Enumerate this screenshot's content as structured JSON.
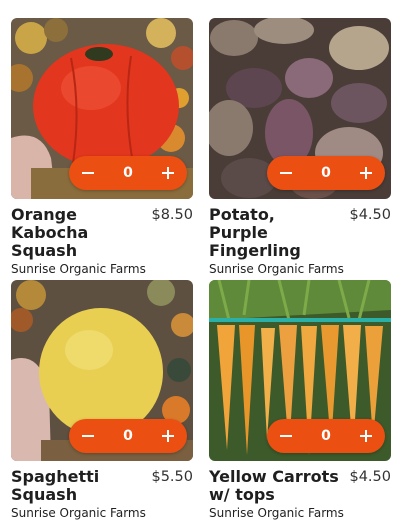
{
  "accent": "#ec4f12",
  "products": [
    {
      "name": "Orange Kabocha Squash",
      "price": "$8.50",
      "farm": "Sunrise Organic Farms",
      "quantity": "0",
      "image": "orange-kabocha-squash-photo"
    },
    {
      "name": "Potato, Purple Fingerling",
      "price": "$4.50",
      "farm": "Sunrise Organic Farms",
      "quantity": "0",
      "image": "purple-fingerling-potato-photo"
    },
    {
      "name": "Spaghetti Squash",
      "price": "$5.50",
      "farm": "Sunrise Organic Farms",
      "quantity": "0",
      "image": "spaghetti-squash-photo"
    },
    {
      "name": "Yellow Carrots w/ tops",
      "price": "$4.50",
      "farm": "Sunrise Organic Farms",
      "quantity": "0",
      "image": "yellow-carrots-photo"
    }
  ]
}
